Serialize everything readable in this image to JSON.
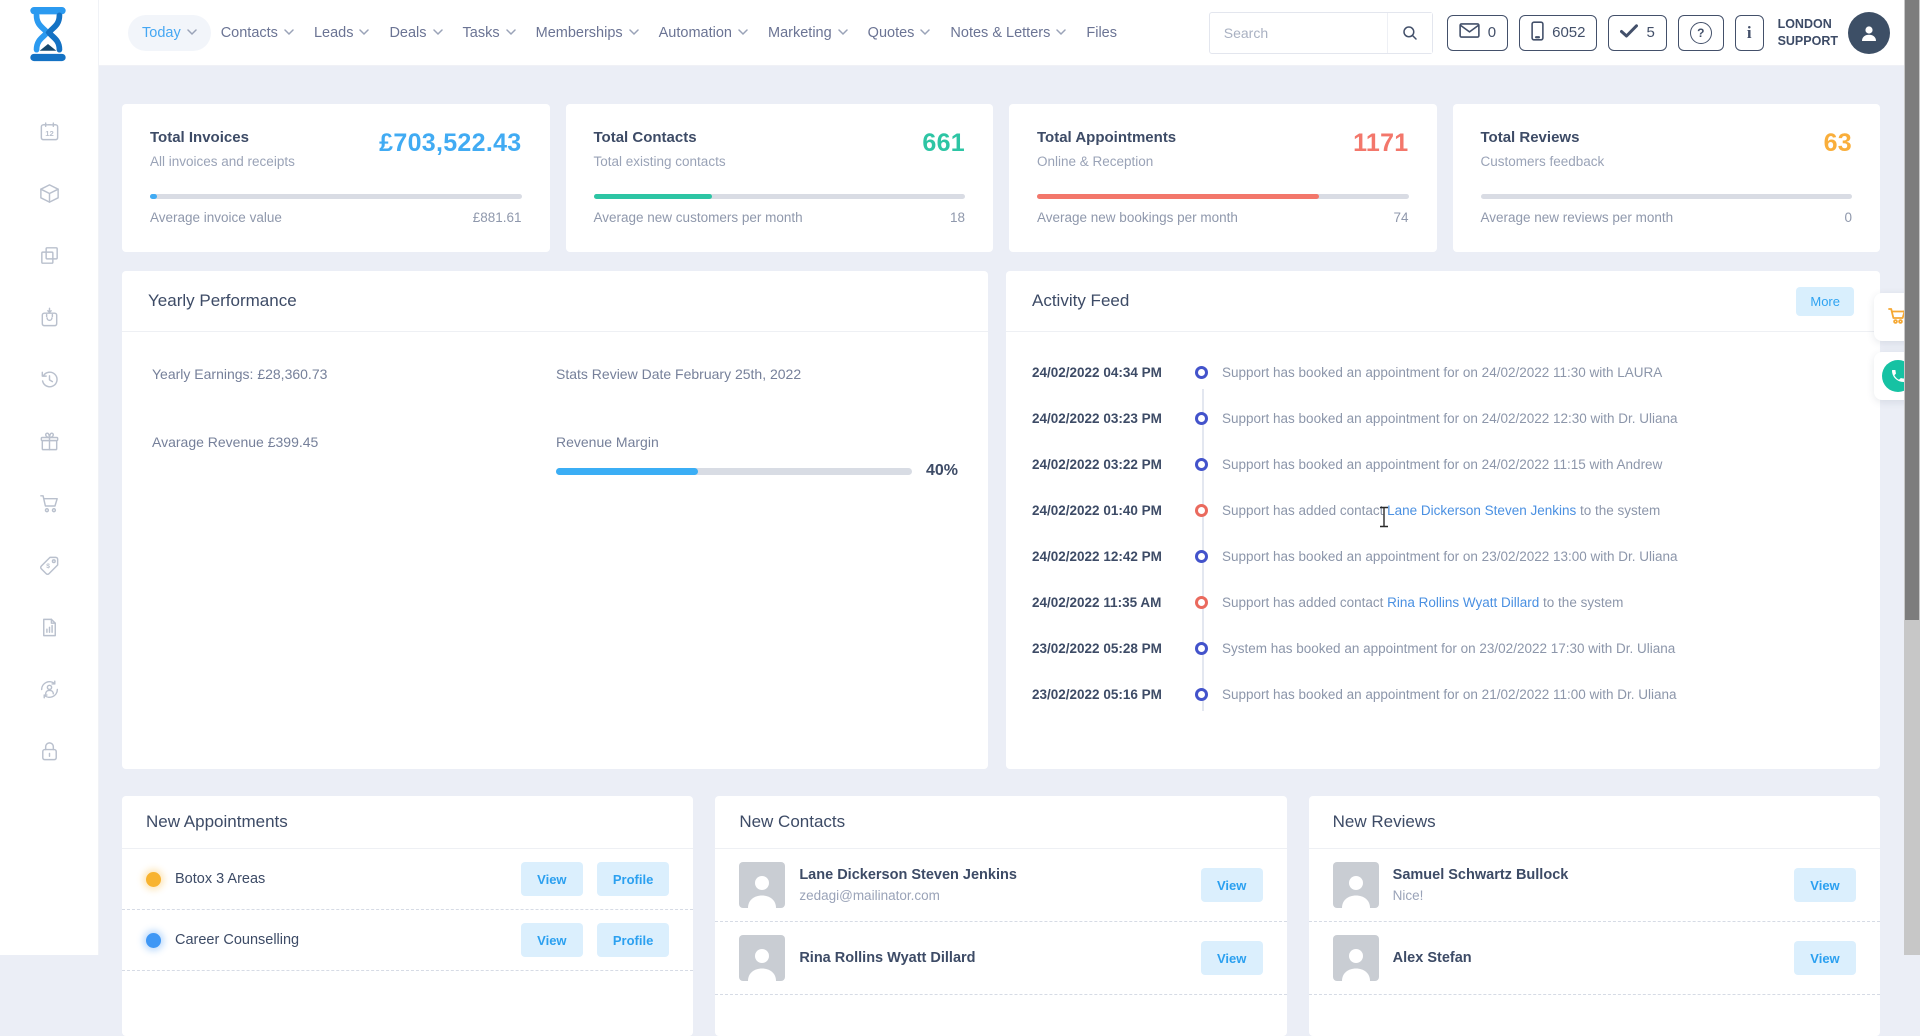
{
  "brand": {
    "logo_icon": "hourglass-logo-icon"
  },
  "nav": {
    "items": [
      {
        "label": "Today",
        "active": true,
        "dropdown": true
      },
      {
        "label": "Contacts",
        "dropdown": true
      },
      {
        "label": "Leads",
        "dropdown": true
      },
      {
        "label": "Deals",
        "dropdown": true
      },
      {
        "label": "Tasks",
        "dropdown": true
      },
      {
        "label": "Memberships",
        "dropdown": true
      },
      {
        "label": "Automation",
        "dropdown": true
      },
      {
        "label": "Marketing",
        "dropdown": true
      },
      {
        "label": "Quotes",
        "dropdown": true
      },
      {
        "label": "Notes & Letters",
        "dropdown": true
      },
      {
        "label": "Files",
        "dropdown": false
      }
    ]
  },
  "header": {
    "search_placeholder": "Search",
    "badges": [
      {
        "icon": "envelope-icon",
        "count": "0"
      },
      {
        "icon": "phone-icon",
        "count": "6052"
      },
      {
        "icon": "check-icon",
        "count": "5"
      }
    ],
    "help_glyph": "?",
    "info_glyph": "i",
    "user": {
      "line1": "LONDON",
      "line2": "SUPPORT",
      "avatar_icon": "user-avatar-icon"
    }
  },
  "stats": [
    {
      "title": "Total Invoices",
      "subtitle": "All invoices and receipts",
      "value": "£703,522.43",
      "color": "#41abf3",
      "progress": 2,
      "footer_label": "Average invoice value",
      "footer_value": "£881.61"
    },
    {
      "title": "Total Contacts",
      "subtitle": "Total existing contacts",
      "value": "661",
      "color": "#2dc5a4",
      "progress": 32,
      "footer_label": "Average new customers per month",
      "footer_value": "18"
    },
    {
      "title": "Total Appointments",
      "subtitle": "Online & Reception",
      "value": "1171",
      "color": "#f3776b",
      "progress": 76,
      "footer_label": "Average new bookings per month",
      "footer_value": "74"
    },
    {
      "title": "Total Reviews",
      "subtitle": "Customers feedback",
      "value": "63",
      "color": "#f9ae3b",
      "progress": 0,
      "footer_label": "Average new reviews per month",
      "footer_value": "0"
    }
  ],
  "yearly": {
    "title": "Yearly Performance",
    "earnings": "Yearly Earnings: £28,360.73",
    "review_date": "Stats Review Date February 25th, 2022",
    "avg_revenue": "Avarage Revenue £399.45",
    "margin_label": "Revenue Margin",
    "margin_value": 40,
    "margin_pct": "40%"
  },
  "activity": {
    "title": "Activity Feed",
    "more_label": "More",
    "items": [
      {
        "time": "24/02/2022 04:34 PM",
        "dot": "blue",
        "text": "Support has booked an appointment for on 24/02/2022 11:30 with LAURA",
        "link": "",
        "suffix": ""
      },
      {
        "time": "24/02/2022 03:23 PM",
        "dot": "blue",
        "text": "Support has booked an appointment for on 24/02/2022 12:30 with Dr. Uliana",
        "link": "",
        "suffix": ""
      },
      {
        "time": "24/02/2022 03:22 PM",
        "dot": "blue",
        "text": "Support has booked an appointment for on 24/02/2022 11:15 with Andrew",
        "link": "",
        "suffix": ""
      },
      {
        "time": "24/02/2022 01:40 PM",
        "dot": "red",
        "text": "Support has added contact ",
        "link": "Lane Dickerson Steven Jenkins",
        "suffix": " to the system"
      },
      {
        "time": "24/02/2022 12:42 PM",
        "dot": "blue",
        "text": "Support has booked an appointment for on 23/02/2022 13:00 with Dr. Uliana",
        "link": "",
        "suffix": ""
      },
      {
        "time": "24/02/2022 11:35 AM",
        "dot": "red",
        "text": "Support has added contact ",
        "link": "Rina Rollins Wyatt Dillard",
        "suffix": " to the system"
      },
      {
        "time": "23/02/2022 05:28 PM",
        "dot": "blue",
        "text": "System has booked an appointment for on 23/02/2022 17:30 with Dr. Uliana",
        "link": "",
        "suffix": ""
      },
      {
        "time": "23/02/2022 05:16 PM",
        "dot": "blue",
        "text": "Support has booked an appointment for on 21/02/2022 11:00 with Dr. Uliana",
        "link": "",
        "suffix": ""
      }
    ]
  },
  "appointments": {
    "title": "New Appointments",
    "view_label": "View",
    "profile_label": "Profile",
    "items": [
      {
        "label": "Botox 3 Areas",
        "dot_color": "#f8b32f"
      },
      {
        "label": "Career Counselling",
        "dot_color": "#3e97f5"
      }
    ]
  },
  "contacts": {
    "title": "New Contacts",
    "view_label": "View",
    "items": [
      {
        "name": "Lane Dickerson Steven Jenkins",
        "email": "zedagi@mailinator.com"
      },
      {
        "name": "Rina Rollins Wyatt Dillard",
        "email": ""
      }
    ]
  },
  "reviews": {
    "title": "New Reviews",
    "view_label": "View",
    "items": [
      {
        "name": "Samuel Schwartz Bullock",
        "comment": "Nice!"
      },
      {
        "name": "Alex Stefan",
        "comment": ""
      }
    ]
  },
  "sidebar": {
    "calendar_label": "12",
    "icons": [
      "calendar-icon",
      "package-icon",
      "copy-icon",
      "bag-icon",
      "history-icon",
      "gift-icon",
      "cart-icon",
      "price-tag-icon",
      "report-icon",
      "user-sync-icon",
      "lock-icon"
    ]
  },
  "colors": {
    "accent_blue": "#36a3f2",
    "link_blue": "#4a90e2",
    "dot_blue": "#4353cb",
    "dot_red": "#ea6a5e",
    "fab_cart": "#f5a833",
    "fab_phone": "#16c2a3",
    "page_bg": "#ebeef6"
  }
}
